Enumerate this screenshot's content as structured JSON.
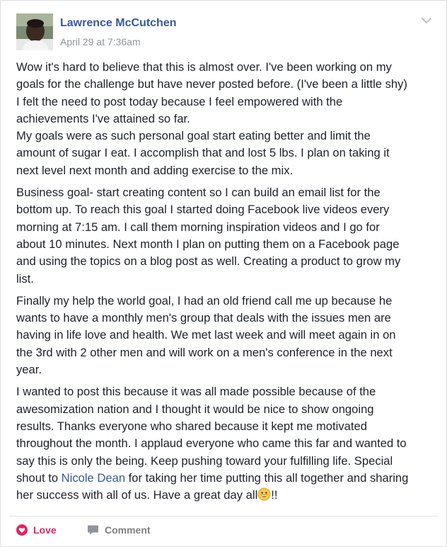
{
  "post": {
    "author": "Lawrence McCutchen",
    "timestamp": "April 29 at 7:36am",
    "paragraphs": [
      {
        "lines": [
          "Wow it's hard to believe that this is almost over. I've been working on my",
          "goals for the challenge but have never posted before. (I've been a little shy)",
          "I felt the need to post today because I feel empowered with the",
          "achievements I've attained so far.",
          "My goals were as such personal goal start eating better and limit the",
          "amount of sugar I eat. I accomplish that and lost 5 lbs. I plan on taking it",
          "next level next month and adding exercise to the mix."
        ]
      },
      {
        "lines": [
          "Business goal- start creating content so I can build an email list for the",
          "bottom up. To reach this goal I started doing Facebook live videos every",
          "morning at 7:15 am. I call them morning inspiration videos and I go for",
          "about 10 minutes. Next month I plan on putting them on a Facebook page",
          "and using the topics on a blog post as well. Creating a product to grow my",
          "list."
        ]
      },
      {
        "lines": [
          "Finally my help the world goal, I had an old friend call me up because he",
          "wants to have a monthly men's group that deals with the issues men are",
          "having in life love and health. We met last week and will meet again in on",
          "the 3rd with 2 other men and will work on a men's conference in the next",
          "year."
        ]
      },
      {
        "lines": [
          "I wanted to post this because it was all made possible because of the",
          "awesomization nation and I thought it would be nice to show ongoing",
          "results. Thanks everyone who shared because it kept me motivated",
          "throughout the month. I applaud everyone who came this far and wanted to",
          "say this is only the being. Keep pushing toward your fulfilling life. Special"
        ],
        "mention_line": {
          "before": "shout to ",
          "mention": "Nicole Dean",
          "after": " for taking her time putting this all together and sharing"
        },
        "last_line": {
          "before": "her success with all of us. Have a great day all",
          "emoji": "grinning-face-emoji",
          "after": "!!"
        }
      }
    ]
  },
  "actions": {
    "love_label": "Love",
    "comment_label": "Comment"
  },
  "icons": {
    "menu": "chevron-down-icon",
    "love": "heart-icon",
    "comment": "speech-bubble-icon"
  },
  "colors": {
    "author_link": "#365899",
    "love": "#e0245e",
    "muted": "#90949c",
    "text": "#1d2129"
  }
}
